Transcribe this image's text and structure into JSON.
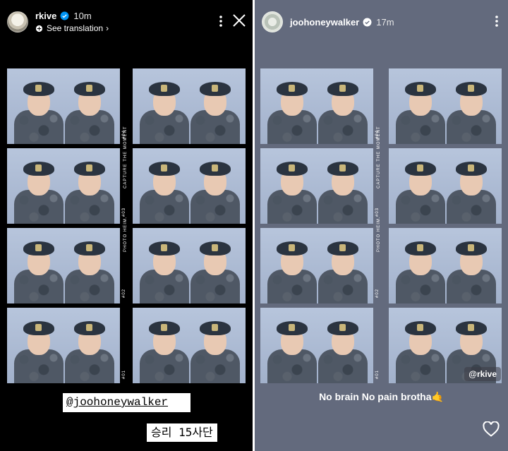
{
  "left_story": {
    "username": "rkive",
    "time": "10m",
    "see_translation": "See translation",
    "film_labels": [
      "#04",
      "#03",
      "#02",
      "#01"
    ],
    "edge_text_a": "CAPTURE THE MOMENT",
    "edge_text_b": "PHOTO HEIM.",
    "tag": "@joohoneywalker",
    "caption": "승리 15사단"
  },
  "right_story": {
    "username": "joohoneywalker",
    "time": "17m",
    "film_labels": [
      "#04",
      "#03",
      "#02",
      "#01"
    ],
    "edge_text_a": "CAPTURE THE MOMENT",
    "edge_text_b": "PHOTO HEIM.",
    "mention": "@rkive",
    "caption": "No brain No pain brotha🤙"
  },
  "icons": {
    "verified": "verified-badge-icon",
    "translate": "translate-icon",
    "more": "more-options-icon",
    "close": "close-icon",
    "heart": "heart-icon"
  },
  "colors": {
    "left_bg": "#000000",
    "right_bg": "#636a7d",
    "verified_blue": "#0095f6"
  }
}
